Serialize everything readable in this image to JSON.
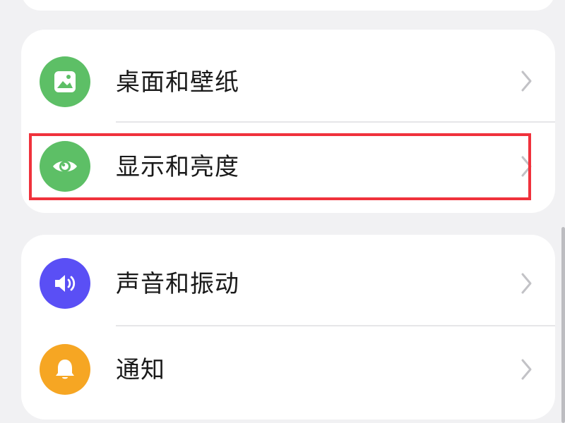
{
  "settings_groups": [
    {
      "items": [
        {
          "label": "桌面和壁纸",
          "icon": "wallpaper-icon",
          "icon_color": "#5dbf66"
        },
        {
          "label": "显示和亮度",
          "icon": "eye-icon",
          "icon_color": "#5dbf66",
          "highlighted": true
        }
      ]
    },
    {
      "items": [
        {
          "label": "声音和振动",
          "icon": "speaker-icon",
          "icon_color": "#5a4ff5"
        },
        {
          "label": "通知",
          "icon": "bell-icon",
          "icon_color": "#f6a623"
        }
      ]
    }
  ],
  "colors": {
    "background": "#f1f1f3",
    "card": "#ffffff",
    "highlight_border": "#f0323c",
    "chevron": "#c2c2c6"
  }
}
